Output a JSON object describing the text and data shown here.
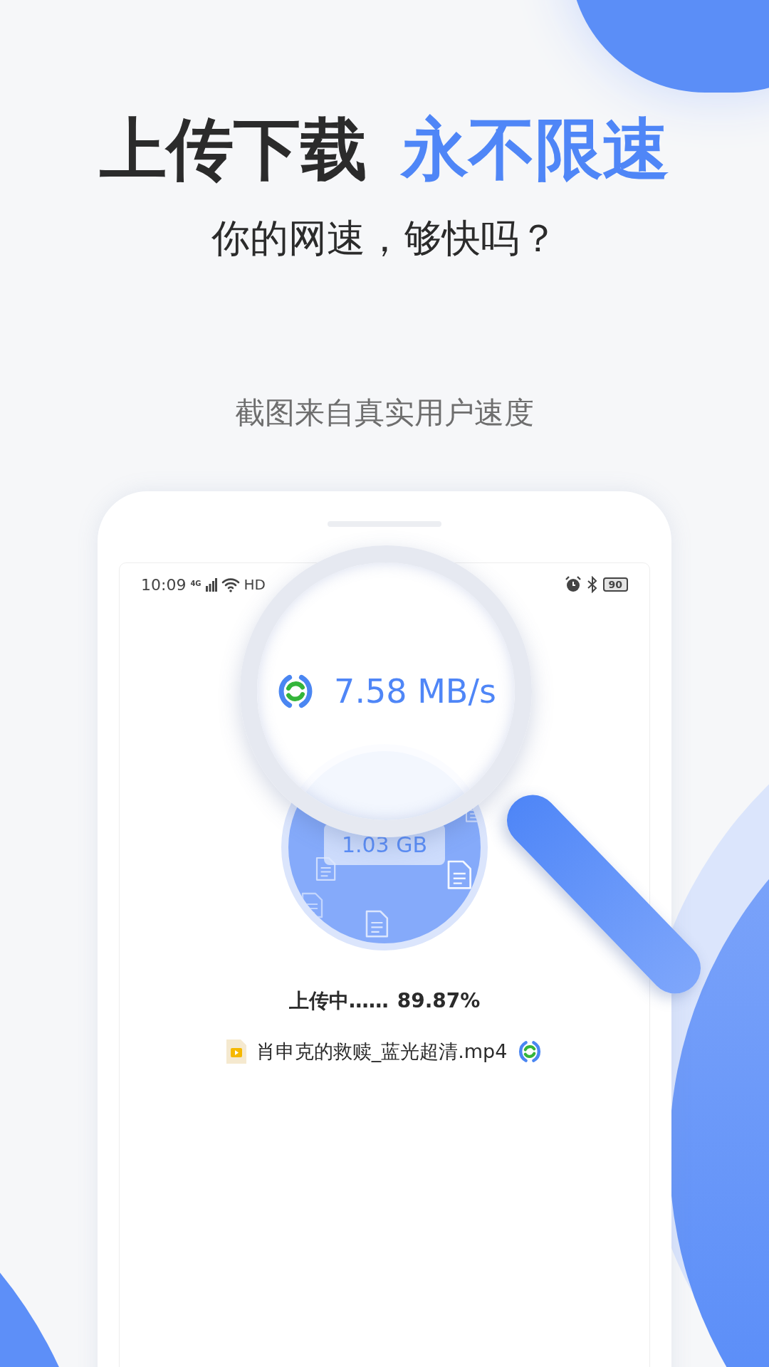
{
  "headline": {
    "normal": "上传下载",
    "highlight": "永不限速"
  },
  "subtitle": "你的网速，够快吗？",
  "caption": "截图来自真实用户速度",
  "phone": {
    "status_bar": {
      "time": "10:09",
      "network": "4G",
      "wifi_label": "HD",
      "battery": "90"
    },
    "speed": "7.58 MB/s",
    "size": "1.03 GB",
    "progress": {
      "label": "上传中……",
      "percent": "89.87%"
    },
    "file": {
      "name": "肖申克的救赎_蓝光超清.mp4"
    }
  }
}
